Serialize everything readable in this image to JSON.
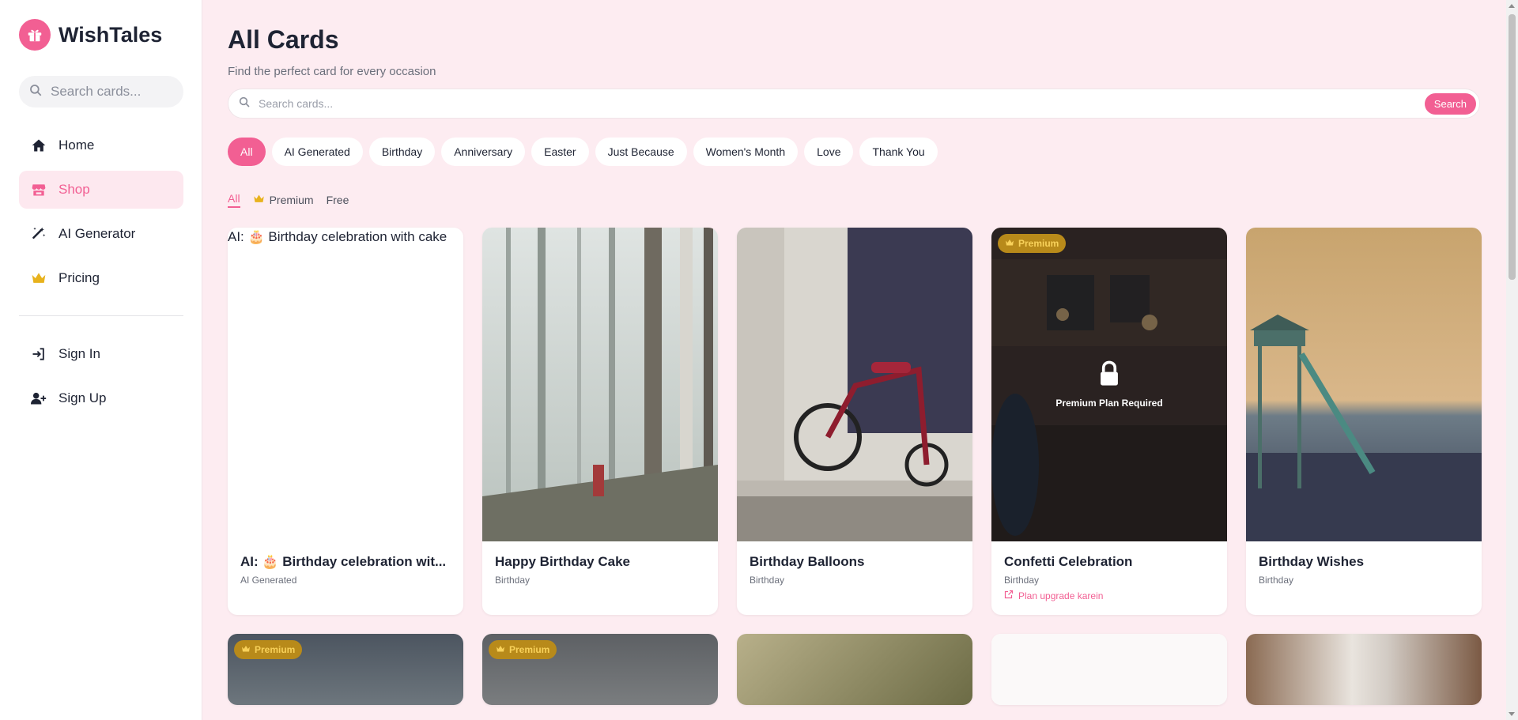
{
  "brand": {
    "name": "WishTales",
    "icon": "gift-icon"
  },
  "sidebar": {
    "search_placeholder": "Search cards...",
    "nav": [
      {
        "label": "Home",
        "icon": "home-icon",
        "active": false
      },
      {
        "label": "Shop",
        "icon": "store-icon",
        "active": true
      },
      {
        "label": "AI Generator",
        "icon": "magic-wand-icon",
        "active": false
      },
      {
        "label": "Pricing",
        "icon": "crown-icon",
        "active": false
      }
    ],
    "auth": [
      {
        "label": "Sign In",
        "icon": "sign-in-icon"
      },
      {
        "label": "Sign Up",
        "icon": "user-plus-icon"
      }
    ]
  },
  "header": {
    "title": "All Cards",
    "subtitle": "Find the perfect card for every occasion",
    "search_placeholder": "Search cards...",
    "search_button": "Search"
  },
  "categories": [
    "All",
    "AI Generated",
    "Birthday",
    "Anniversary",
    "Easter",
    "Just Because",
    "Women's Month",
    "Love",
    "Thank You"
  ],
  "filters": {
    "all": "All",
    "premium": "Premium",
    "free": "Free"
  },
  "cards": [
    {
      "title": "AI: 🎂 Birthday celebration wit...",
      "category": "AI Generated",
      "alt": "AI: 🎂 Birthday celebration with cake",
      "premium": false
    },
    {
      "title": "Happy Birthday Cake",
      "category": "Birthday",
      "premium": false
    },
    {
      "title": "Birthday Balloons",
      "category": "Birthday",
      "premium": false
    },
    {
      "title": "Confetti Celebration",
      "category": "Birthday",
      "premium": true,
      "lock_text": "Premium Plan Required",
      "upgrade_link": "Plan upgrade karein"
    },
    {
      "title": "Birthday Wishes",
      "category": "Birthday",
      "premium": false
    }
  ],
  "badge_label": "Premium",
  "colors": {
    "accent": "#f25f93",
    "background": "#fdecf1",
    "premium_gold": "#e8b21d"
  }
}
